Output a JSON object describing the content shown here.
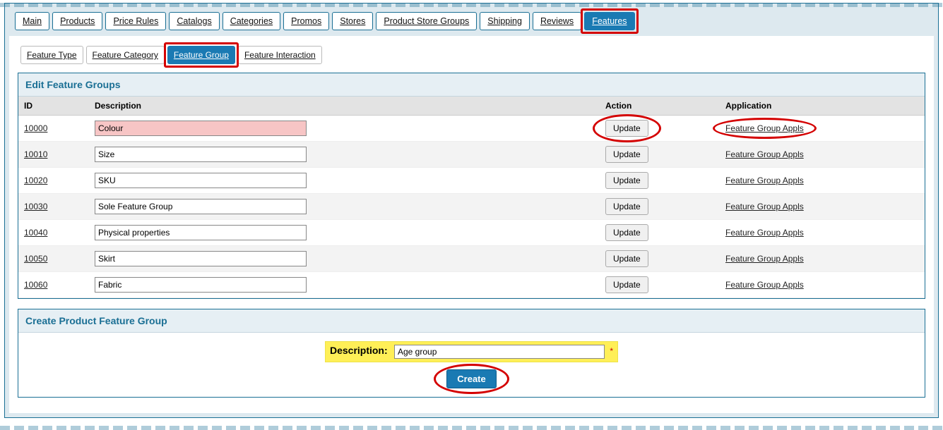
{
  "nav": {
    "items": [
      {
        "label": "Main",
        "active": false
      },
      {
        "label": "Products",
        "active": false
      },
      {
        "label": "Price Rules",
        "active": false
      },
      {
        "label": "Catalogs",
        "active": false
      },
      {
        "label": "Categories",
        "active": false
      },
      {
        "label": "Promos",
        "active": false
      },
      {
        "label": "Stores",
        "active": false
      },
      {
        "label": "Product Store Groups",
        "active": false
      },
      {
        "label": "Shipping",
        "active": false
      },
      {
        "label": "Reviews",
        "active": false
      },
      {
        "label": "Features",
        "active": true
      }
    ]
  },
  "subnav": {
    "items": [
      {
        "label": "Feature Type",
        "active": false
      },
      {
        "label": "Feature Category",
        "active": false
      },
      {
        "label": "Feature Group",
        "active": true
      },
      {
        "label": "Feature Interaction",
        "active": false
      }
    ]
  },
  "edit_panel": {
    "title": "Edit Feature Groups",
    "columns": {
      "id": "ID",
      "description": "Description",
      "action": "Action",
      "application": "Application"
    },
    "action_label": "Update",
    "app_label": "Feature Group Appls",
    "rows": [
      {
        "id": "10000",
        "description": "Colour",
        "hl_desc": true,
        "hl_action": true,
        "hl_app": true
      },
      {
        "id": "10010",
        "description": "Size"
      },
      {
        "id": "10020",
        "description": "SKU"
      },
      {
        "id": "10030",
        "description": "Sole Feature Group"
      },
      {
        "id": "10040",
        "description": "Physical properties"
      },
      {
        "id": "10050",
        "description": "Skirt"
      },
      {
        "id": "10060",
        "description": "Fabric"
      }
    ]
  },
  "create_panel": {
    "title": "Create Product Feature Group",
    "desc_label": "Description:",
    "desc_value": "Age group",
    "required": "*",
    "create_label": "Create"
  }
}
